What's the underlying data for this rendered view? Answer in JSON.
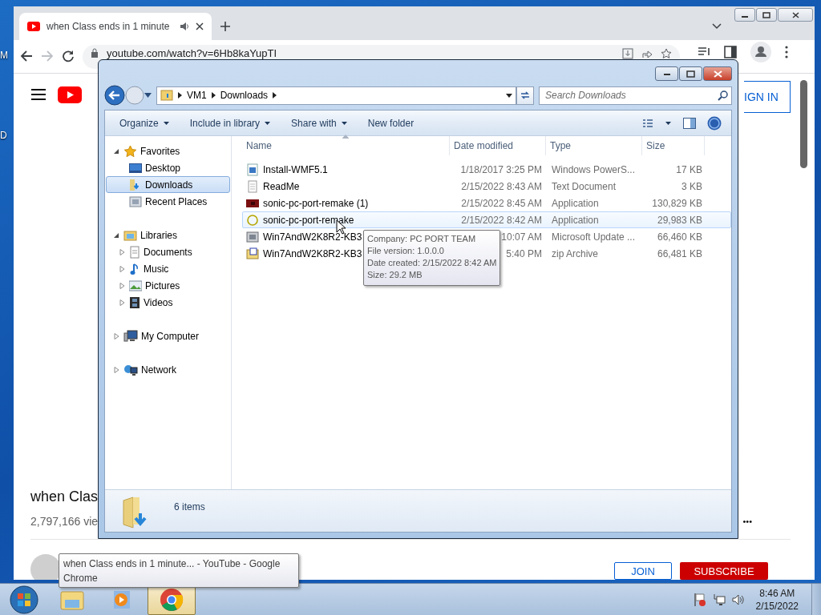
{
  "desktop": {
    "icon_labels": [
      "M",
      "D"
    ]
  },
  "chrome": {
    "tab": {
      "title": "when Class ends in 1 minute",
      "playing_audio": true
    },
    "url": "youtube.com/watch?v=6Hb8kaYupTI",
    "page": {
      "sign_in": "IGN IN",
      "video_title": "when Clas",
      "views": "2,797,166 vie",
      "more": "•••",
      "join": "JOIN",
      "subscribe": "SUBSCRIBE"
    }
  },
  "explorer": {
    "breadcrumb": [
      "VM1",
      "Downloads"
    ],
    "search": {
      "placeholder": "Search Downloads"
    },
    "toolbar": [
      {
        "label": "Organize",
        "menu": true
      },
      {
        "label": "Include in library",
        "menu": true
      },
      {
        "label": "Share with",
        "menu": true
      },
      {
        "label": "New folder",
        "menu": false
      }
    ],
    "nav": [
      {
        "label": "Favorites",
        "kind": "star",
        "expanded": true,
        "selected": false,
        "children": [
          {
            "label": "Desktop",
            "kind": "desktop",
            "selected": false
          },
          {
            "label": "Downloads",
            "kind": "downloads",
            "selected": true
          },
          {
            "label": "Recent Places",
            "kind": "recent",
            "selected": false
          }
        ]
      },
      {
        "label": "Libraries",
        "kind": "library",
        "expanded": true,
        "selected": false,
        "children": [
          {
            "label": "Documents",
            "kind": "documents",
            "expanded": false,
            "selected": false
          },
          {
            "label": "Music",
            "kind": "music",
            "expanded": false,
            "selected": false
          },
          {
            "label": "Pictures",
            "kind": "pictures",
            "expanded": false,
            "selected": false
          },
          {
            "label": "Videos",
            "kind": "videos",
            "expanded": false,
            "selected": false
          }
        ]
      },
      {
        "label": "My Computer",
        "kind": "computer",
        "expanded": false,
        "selected": false
      },
      {
        "label": "Network",
        "kind": "network",
        "expanded": false,
        "selected": false
      }
    ],
    "columns": [
      {
        "label": "Name",
        "sorted": true
      },
      {
        "label": "Date modified",
        "sorted": false
      },
      {
        "label": "Type",
        "sorted": false
      },
      {
        "label": "Size",
        "sorted": false
      }
    ],
    "files": [
      {
        "name": "Install-WMF5.1",
        "date": "1/18/2017 3:25 PM",
        "type": "Windows PowerS...",
        "size": "17 KB",
        "kind": "script",
        "hovered": false
      },
      {
        "name": "ReadMe",
        "date": "2/15/2022 8:43 AM",
        "type": "Text Document",
        "size": "3 KB",
        "kind": "text",
        "hovered": false
      },
      {
        "name": "sonic-pc-port-remake (1)",
        "date": "2/15/2022 8:45 AM",
        "type": "Application",
        "size": "130,829 KB",
        "kind": "app",
        "hovered": false
      },
      {
        "name": "sonic-pc-port-remake",
        "date": "2/15/2022 8:42 AM",
        "type": "Application",
        "size": "29,983 KB",
        "kind": "ring",
        "hovered": true
      },
      {
        "name": "Win7AndW2K8R2-KB3",
        "date": "10:07 AM",
        "type": "Microsoft Update ...",
        "size": "66,460 KB",
        "kind": "update",
        "hovered": false
      },
      {
        "name": "Win7AndW2K8R2-KB3",
        "date": "5:40 PM",
        "type": "zip Archive",
        "size": "66,481 KB",
        "kind": "zip",
        "hovered": false
      }
    ],
    "tooltip": [
      "Company: PC PORT TEAM",
      "File version: 1.0.0.0",
      "Date created: 2/15/2022 8:42 AM",
      "Size: 29.2 MB"
    ],
    "status": "6 items"
  },
  "taskbar": {
    "items": [
      {
        "kind": "explorer",
        "selected": false
      },
      {
        "kind": "media",
        "selected": false
      },
      {
        "kind": "chrome",
        "selected": true
      }
    ],
    "tooltip": "when Class ends in 1 minute... - YouTube - Google Chrome",
    "clock": {
      "time": "8:46 AM",
      "date": "2/15/2022"
    }
  }
}
